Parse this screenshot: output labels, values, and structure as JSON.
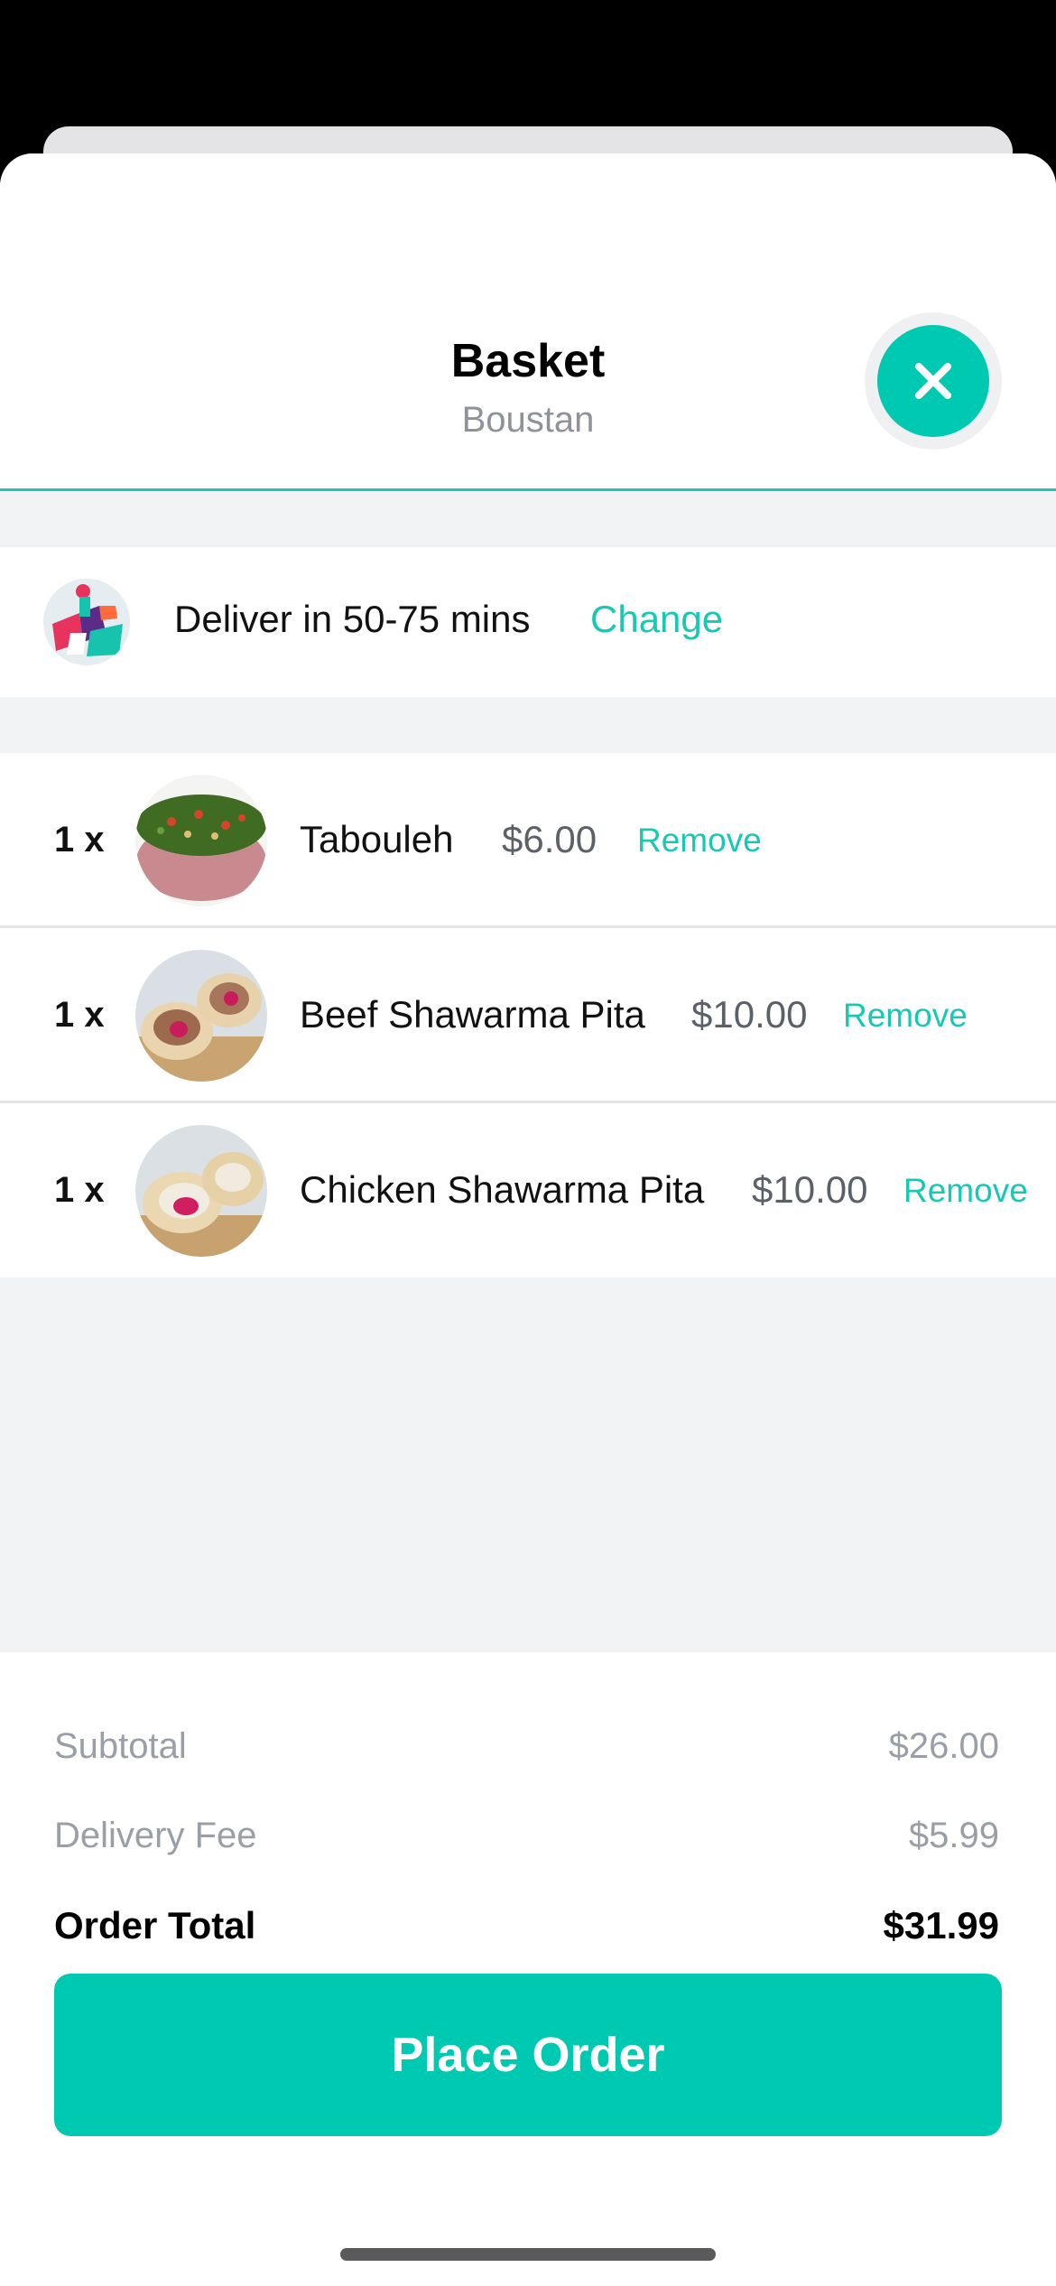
{
  "header": {
    "title": "Basket",
    "subtitle": "Boustan",
    "close_icon": "close-icon"
  },
  "delivery": {
    "text": "Deliver in 50-75 mins",
    "change_label": "Change",
    "avatar_icon": "delivery-rider-icon"
  },
  "items": [
    {
      "qty": "1 x",
      "name": "Tabouleh",
      "price": "$6.00",
      "remove": "Remove"
    },
    {
      "qty": "1 x",
      "name": "Beef Shawarma Pita",
      "price": "$10.00",
      "remove": "Remove"
    },
    {
      "qty": "1 x",
      "name": "Chicken Shawarma Pita",
      "price": "$10.00",
      "remove": "Remove"
    }
  ],
  "summary": {
    "subtotal_label": "Subtotal",
    "subtotal_value": "$26.00",
    "delivery_fee_label": "Delivery Fee",
    "delivery_fee_value": "$5.99",
    "total_label": "Order Total",
    "total_value": "$31.99"
  },
  "cta": {
    "label": "Place Order"
  },
  "colors": {
    "accent": "#00c9b1",
    "muted_text": "#9a9ea6",
    "background": "#f2f3f5"
  }
}
